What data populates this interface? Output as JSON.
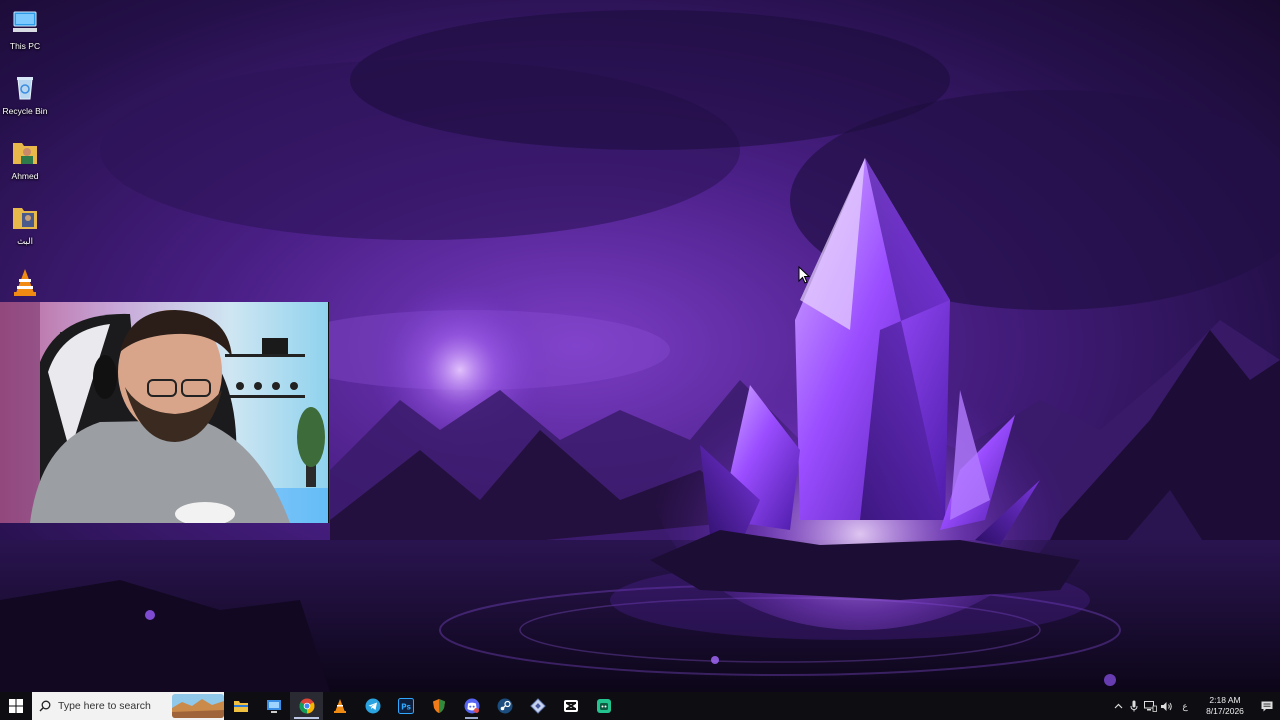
{
  "desktop": {
    "icons": [
      {
        "label": "This PC",
        "icon": "this-pc-icon"
      },
      {
        "label": "Recycle Bin",
        "icon": "recycle-bin-icon"
      },
      {
        "label": "Ahmed",
        "icon": "user-folder-icon"
      },
      {
        "label": "البث",
        "icon": "folder-icon"
      },
      {
        "label": "",
        "icon": "vlc-icon"
      }
    ]
  },
  "taskbar": {
    "search_placeholder": "Type here to search",
    "apps": [
      {
        "name": "File Explorer",
        "icon": "file-explorer-icon",
        "running": false
      },
      {
        "name": "Remote Desktop",
        "icon": "remote-desktop-icon",
        "running": false
      },
      {
        "name": "Google Chrome",
        "icon": "chrome-icon",
        "running": true,
        "active": true
      },
      {
        "name": "VLC media player",
        "icon": "vlc-icon",
        "running": false
      },
      {
        "name": "Telegram",
        "icon": "telegram-icon",
        "running": false
      },
      {
        "name": "Photoshop",
        "icon": "photoshop-icon",
        "running": false
      },
      {
        "name": "Browser",
        "icon": "shield-browser-icon",
        "running": false
      },
      {
        "name": "Discord",
        "icon": "discord-icon",
        "running": true
      },
      {
        "name": "Steam",
        "icon": "steam-icon",
        "running": false
      },
      {
        "name": "App",
        "icon": "diamond-app-icon",
        "running": false
      },
      {
        "name": "CapCut",
        "icon": "capcut-icon",
        "running": false
      },
      {
        "name": "App",
        "icon": "green-app-icon",
        "running": false
      }
    ],
    "tray": {
      "language": "ع",
      "time": "2:18 AM",
      "date": "8/17/2026"
    }
  },
  "colors": {
    "accent": "#8a3cff",
    "taskbar": "#0d0d12",
    "search_bg": "#f2f2f2"
  }
}
